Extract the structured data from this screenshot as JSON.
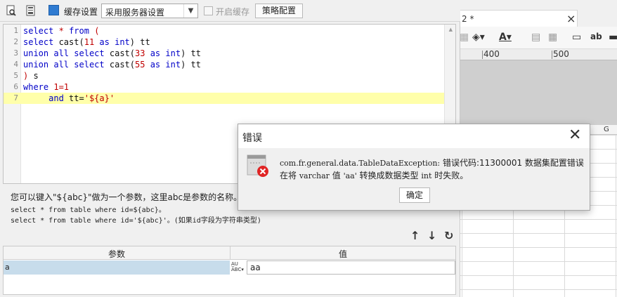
{
  "toolbar": {
    "cache_settings_label": "缓存设置",
    "cache_mode_selected": "采用服务器设置",
    "enable_cache_label": "开启缓存",
    "strategy_button": "策略配置"
  },
  "editor": {
    "lines": [
      {
        "n": "1",
        "tokens": [
          {
            "t": "select",
            "c": "kw"
          },
          {
            "t": " "
          },
          {
            "t": "*",
            "c": "num"
          },
          {
            "t": " "
          },
          {
            "t": "from",
            "c": "kw"
          },
          {
            "t": " "
          },
          {
            "t": "(",
            "c": "num"
          }
        ]
      },
      {
        "n": "2",
        "tokens": [
          {
            "t": "select",
            "c": "kw"
          },
          {
            "t": " cast("
          },
          {
            "t": "11",
            "c": "num"
          },
          {
            "t": " "
          },
          {
            "t": "as",
            "c": "kw"
          },
          {
            "t": " "
          },
          {
            "t": "int",
            "c": "kw"
          },
          {
            "t": ") tt"
          }
        ]
      },
      {
        "n": "3",
        "tokens": [
          {
            "t": "union",
            "c": "kw"
          },
          {
            "t": " "
          },
          {
            "t": "all",
            "c": "kw"
          },
          {
            "t": " "
          },
          {
            "t": "select",
            "c": "kw"
          },
          {
            "t": " cast("
          },
          {
            "t": "33",
            "c": "num"
          },
          {
            "t": " "
          },
          {
            "t": "as",
            "c": "kw"
          },
          {
            "t": " "
          },
          {
            "t": "int",
            "c": "kw"
          },
          {
            "t": ") tt"
          }
        ]
      },
      {
        "n": "4",
        "tokens": [
          {
            "t": "union",
            "c": "kw"
          },
          {
            "t": " "
          },
          {
            "t": "all",
            "c": "kw"
          },
          {
            "t": " "
          },
          {
            "t": "select",
            "c": "kw"
          },
          {
            "t": " cast("
          },
          {
            "t": "55",
            "c": "num"
          },
          {
            "t": " "
          },
          {
            "t": "as",
            "c": "kw"
          },
          {
            "t": " "
          },
          {
            "t": "int",
            "c": "kw"
          },
          {
            "t": ") tt"
          }
        ]
      },
      {
        "n": "5",
        "tokens": [
          {
            "t": ")",
            "c": "num"
          },
          {
            "t": " s"
          }
        ]
      },
      {
        "n": "6",
        "tokens": [
          {
            "t": "where",
            "c": "kw"
          },
          {
            "t": " "
          },
          {
            "t": "1=1",
            "c": "num"
          }
        ]
      },
      {
        "n": "7",
        "highlight": true,
        "tokens": [
          {
            "t": "     "
          },
          {
            "t": "and",
            "c": "kw"
          },
          {
            "t": " tt="
          },
          {
            "t": "'${a}'",
            "c": "str"
          }
        ]
      }
    ]
  },
  "help": {
    "line1": "您可以键入\"${abc}\"做为一个参数，这里abc是参数的名称。例",
    "line2": "select * from table where id=${abc}。",
    "line3": "select * from table where id='${abc}'。(如果id字段为字符串类型)"
  },
  "params": {
    "header_param": "参数",
    "header_value": "值",
    "rows": [
      {
        "name": "a",
        "value": "aa"
      }
    ],
    "type_icon_top": "A̲U",
    "type_icon_bottom": "ABC"
  },
  "error_dialog": {
    "title": "错误",
    "message_line1_class": "com.fr.general.data.TableDataException:",
    "message_line1_rest": " 错误代码:11300001 数据集配置错误",
    "message_line2_a": "在将 ",
    "message_line2_b": "varchar",
    "message_line2_c": " 值 ",
    "message_line2_d": "'aa'",
    "message_line2_e": " 转换成数据类型 ",
    "message_line2_f": "int",
    "message_line2_g": " 时失败。",
    "ok_button": "确定",
    "close_glyph": "✕"
  },
  "background_designer": {
    "tab_label": "2 *",
    "tab_close": "×",
    "ruler_400": "400",
    "ruler_500": "500",
    "column_g": "G"
  },
  "colors": {
    "keyword": "#0000c8",
    "number_string": "#c00000",
    "highlight_line": "#ffffaa",
    "selected_row": "#c7dceb",
    "error_red": "#e02424"
  }
}
